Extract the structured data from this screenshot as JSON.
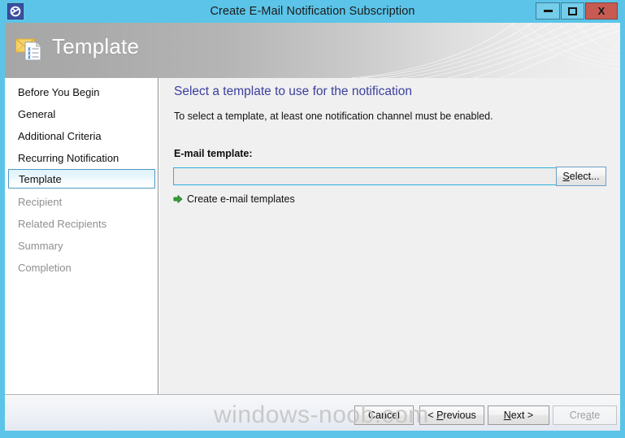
{
  "window": {
    "title": "Create E-Mail Notification Subscription",
    "icon": "app-icon",
    "controls": {
      "minimize": "minimize-icon",
      "maximize": "maximize-icon",
      "close": "X"
    },
    "frame_color": "#5bc4e8"
  },
  "banner": {
    "title": "Template",
    "icon": "email-template-icon"
  },
  "sidebar": {
    "items": [
      {
        "label": "Before You Begin",
        "state": "normal"
      },
      {
        "label": "General",
        "state": "normal"
      },
      {
        "label": "Additional Criteria",
        "state": "normal"
      },
      {
        "label": "Recurring Notification",
        "state": "normal"
      },
      {
        "label": "Template",
        "state": "selected"
      },
      {
        "label": "Recipient",
        "state": "disabled"
      },
      {
        "label": "Related Recipients",
        "state": "disabled"
      },
      {
        "label": "Summary",
        "state": "disabled"
      },
      {
        "label": "Completion",
        "state": "disabled"
      }
    ]
  },
  "main": {
    "heading": "Select a template to use for the notification",
    "heading_color": "#3b3f9e",
    "subtext": "To select a template, at least one notification channel must be enabled.",
    "field_label": "E-mail template:",
    "template_value": "",
    "template_placeholder": "",
    "select_button": {
      "prefix": "",
      "accel": "S",
      "suffix": "elect..."
    },
    "create_link": {
      "label": "Create e-mail templates",
      "icon": "green-arrow-icon"
    }
  },
  "footer": {
    "buttons": [
      {
        "name": "cancel",
        "prefix": "Cancel",
        "accel": "",
        "suffix": "",
        "disabled": false
      },
      {
        "name": "previous",
        "prefix": "< ",
        "accel": "P",
        "suffix": "revious",
        "disabled": false
      },
      {
        "name": "next",
        "prefix": "",
        "accel": "N",
        "suffix": "ext >",
        "disabled": false
      },
      {
        "name": "create",
        "prefix": "Cre",
        "accel": "a",
        "suffix": "te",
        "disabled": true
      }
    ]
  },
  "watermark": {
    "text": "windows-noob.com"
  }
}
